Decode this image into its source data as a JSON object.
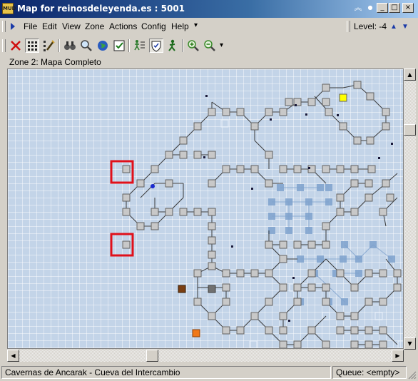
{
  "window": {
    "title": "Map for reinosdeleyenda.es : 5001",
    "app_icon_text": "MUD",
    "buttons": {
      "collapse": "︽",
      "pin": "●",
      "minimize": "_",
      "maximize": "□",
      "close": "×"
    }
  },
  "menubar": {
    "run_icon": "play-icon",
    "items": [
      "File",
      "Edit",
      "View",
      "Zone",
      "Actions",
      "Config",
      "Help"
    ],
    "overflow": "▾",
    "level_label": "Level: -4",
    "level_up": "▲",
    "level_down": "▼"
  },
  "toolbar": {
    "tools": [
      "delete-icon",
      "room-grid-icon",
      "path-edit-icon",
      "binoculars-icon",
      "search-icon",
      "globe-icon",
      "check-icon",
      "walker-list-icon",
      "shield-icon",
      "person-walk-icon",
      "zoom-in-icon",
      "zoom-out-icon"
    ],
    "overflow": "▾"
  },
  "zone": {
    "label": "Zone 2: Mapa Completo"
  },
  "map": {
    "background": "#c3d4e8",
    "room_color": "#c8c8c8",
    "ghost_room_color": "#7ea1cd",
    "highlight_color": "#e0101a",
    "special_rooms": {
      "yellow": "#ffff00",
      "brown": "#7a3e12",
      "gray": "#707070",
      "orange": "#f07818"
    }
  },
  "status": {
    "location": "Cavernas de Ancarak - Cueva del Intercambio",
    "queue": "Queue: <empty>"
  }
}
